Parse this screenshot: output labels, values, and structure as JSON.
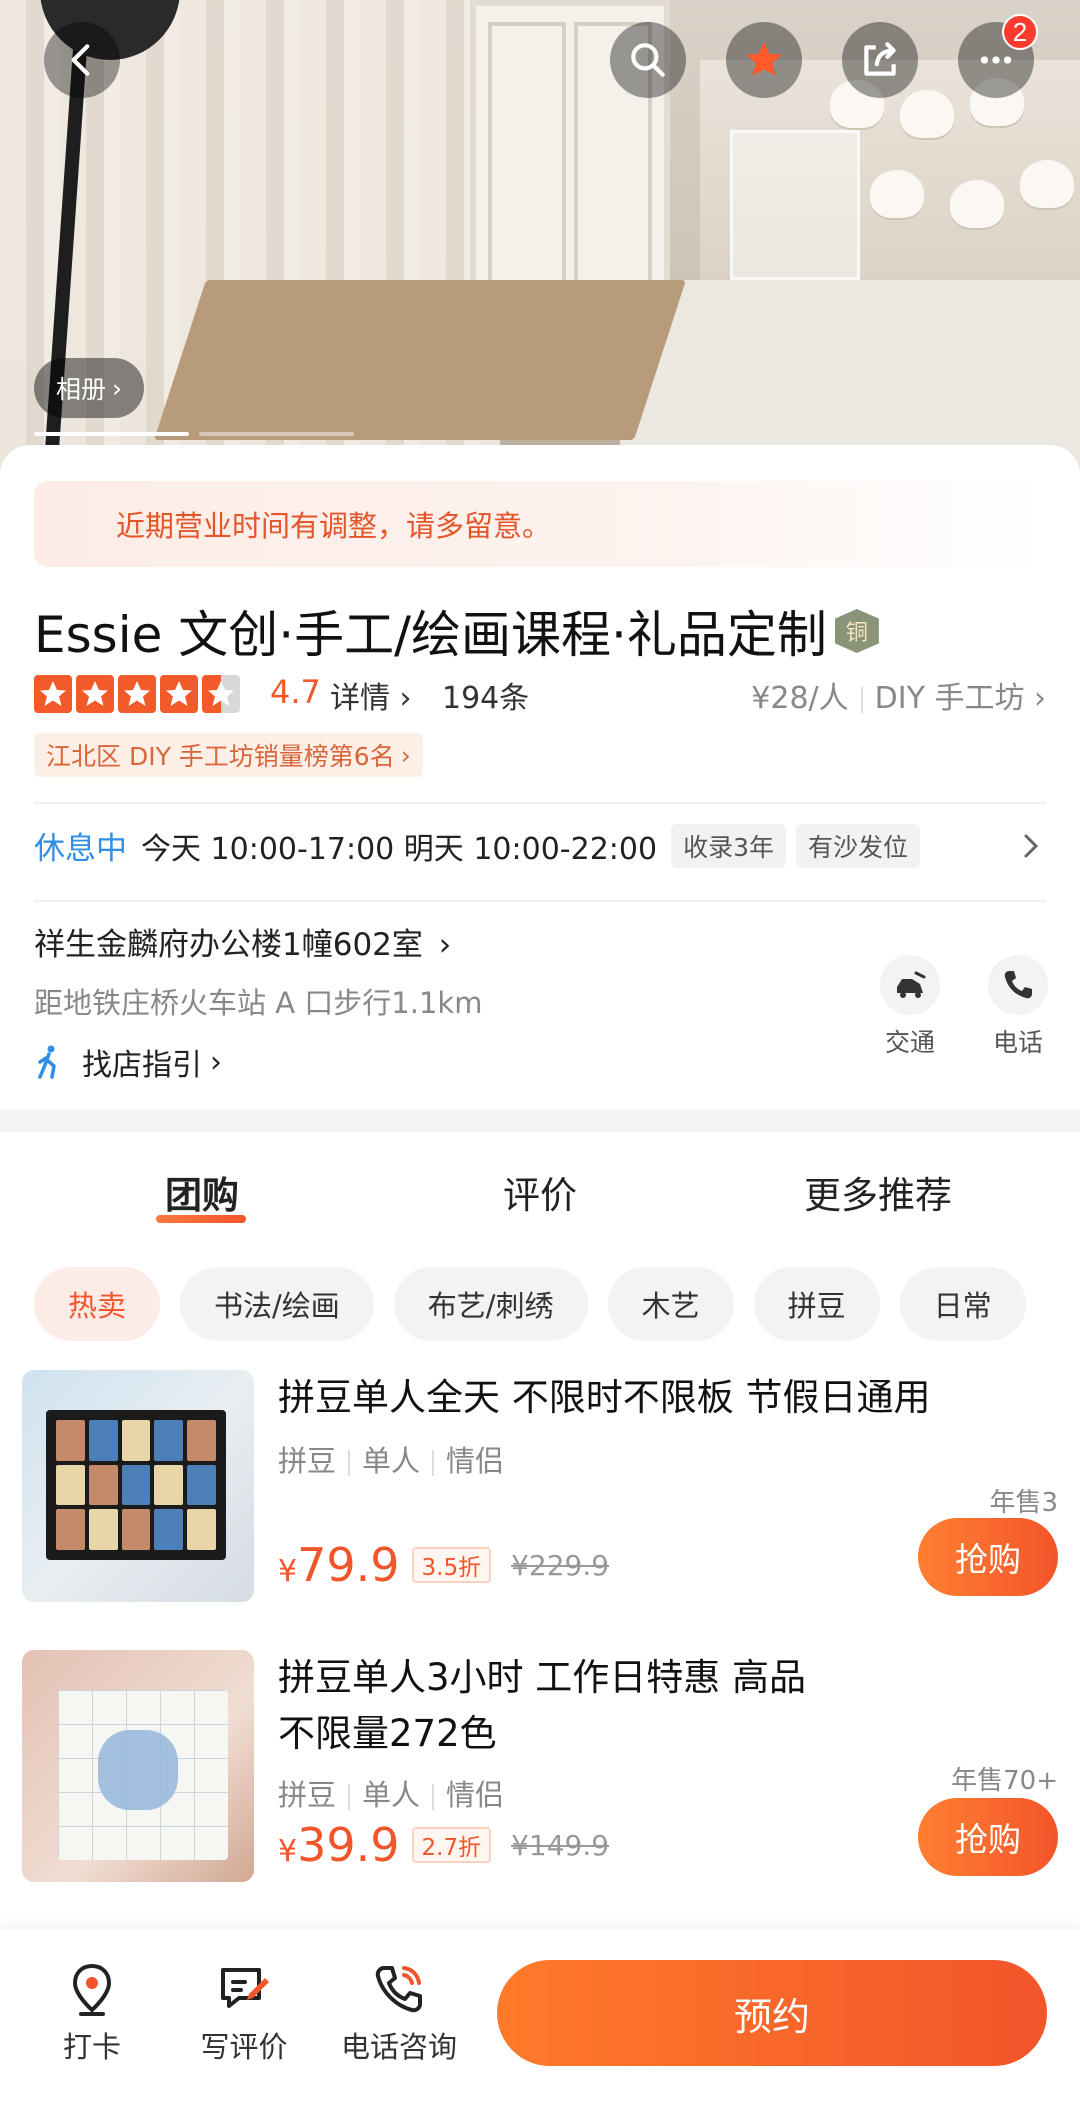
{
  "header": {
    "notification_count": "2",
    "album_label": "相册",
    "icons": [
      "back-icon",
      "search-icon",
      "favorite-star-icon",
      "share-icon",
      "more-icon"
    ],
    "accent_color": "#f2552a"
  },
  "shop": {
    "notice": "近期营业时间有调整，请多留意。",
    "title": "Essie 文创·手工/绘画课程·礼品定制",
    "medal": "铜",
    "score": "4.7",
    "rating_value": 4.5,
    "rating_max": 5,
    "detail_label": "详情",
    "review_count": "194条",
    "price_per_person": "¥28/人",
    "category": "DIY 手工坊",
    "rank_tag": "江北区 DIY 手工坊销量榜第6名",
    "status": "休息中",
    "hours": "今天 10:00-17:00 明天 10:00-22:00",
    "chips": [
      "收录3年",
      "有沙发位"
    ],
    "address": "祥生金麟府办公楼1幢602室",
    "metro": "距地铁庄桥火车站 A 口步行1.1km",
    "guide": "找店指引",
    "actions": {
      "transport": "交通",
      "phone": "电话"
    }
  },
  "tabs": [
    {
      "label": "团购",
      "active": true
    },
    {
      "label": "评价",
      "active": false
    },
    {
      "label": "更多推荐",
      "active": false
    }
  ],
  "categories": [
    "热卖",
    "书法/绘画",
    "布艺/刺绣",
    "木艺",
    "拼豆",
    "日常"
  ],
  "deals": [
    {
      "name": "拼豆单人全天 不限时不限板 节假日通用",
      "tags": [
        "拼豆",
        "单人",
        "情侣"
      ],
      "sold": "年售3",
      "price_yen": "¥",
      "price": "79.9",
      "discount": "3.5折",
      "original": "¥229.9",
      "buy_label": "抢购"
    },
    {
      "name": "拼豆单人3小时 工作日特惠 高品不限量272色",
      "tags": [
        "拼豆",
        "单人",
        "情侣"
      ],
      "sold": "年售70+",
      "price_yen": "¥",
      "price": "39.9",
      "discount": "2.7折",
      "original": "¥149.9",
      "buy_label": "抢购"
    }
  ],
  "bottom_bar": {
    "checkin": "打卡",
    "write_review": "写评价",
    "phone_consult": "电话咨询",
    "reserve": "预约"
  }
}
